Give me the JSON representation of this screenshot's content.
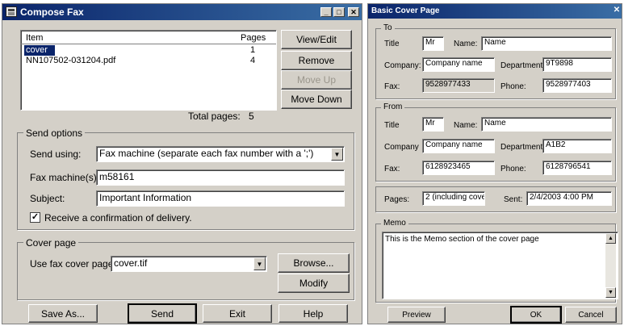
{
  "compose_fax": {
    "title": "Compose Fax",
    "list": {
      "header_item": "Item",
      "header_pages": "Pages",
      "rows": [
        {
          "item": "cover",
          "pages": "1"
        },
        {
          "item": "NN107502-031204.pdf",
          "pages": "4"
        }
      ]
    },
    "buttons": {
      "view_edit": "View/Edit",
      "remove": "Remove",
      "move_up": "Move Up",
      "move_down": "Move Down",
      "browse": "Browse...",
      "modify": "Modify",
      "save_as": "Save As...",
      "send": "Send",
      "exit": "Exit",
      "help": "Help"
    },
    "total_pages_label": "Total pages:",
    "total_pages_value": "5",
    "send_options": {
      "legend": "Send options",
      "send_using_label": "Send using:",
      "send_using_value": "Fax machine (separate each fax number with a ';')",
      "fax_machines_label": "Fax machine(s):",
      "fax_machines_value": "m58161",
      "subject_label": "Subject:",
      "subject_value": "Important Information",
      "confirm_label": "Receive a confirmation of delivery.",
      "confirm_checked": true
    },
    "cover_page": {
      "legend": "Cover page",
      "use_label": "Use fax cover page:",
      "use_value": "cover.tif"
    }
  },
  "basic_cover": {
    "title": "Basic Cover Page",
    "to": {
      "legend": "To",
      "title_label": "Title",
      "title_value": "Mr",
      "name_label": "Name:",
      "name_value": "Name",
      "company_label": "Company:",
      "company_value": "Company name",
      "department_label": "Department",
      "department_value": "9T9898",
      "fax_label": "Fax:",
      "fax_value": "9528977433",
      "phone_label": "Phone:",
      "phone_value": "9528977403"
    },
    "from": {
      "legend": "From",
      "title_label": "Title",
      "title_value": "Mr",
      "name_label": "Name:",
      "name_value": "Name",
      "company_label": "Company",
      "company_value": "Company name",
      "department_label": "Department",
      "department_value": "A1B2",
      "fax_label": "Fax:",
      "fax_value": "6128923465",
      "phone_label": "Phone:",
      "phone_value": "6128796541"
    },
    "pages_label": "Pages:",
    "pages_value": "2 (including cover)",
    "sent_label": "Sent:",
    "sent_value": "2/4/2003 4:00 PM",
    "memo": {
      "legend": "Memo",
      "value": "This is the Memo section of the cover page"
    },
    "buttons": {
      "preview": "Preview",
      "ok": "OK",
      "cancel": "Cancel"
    }
  }
}
